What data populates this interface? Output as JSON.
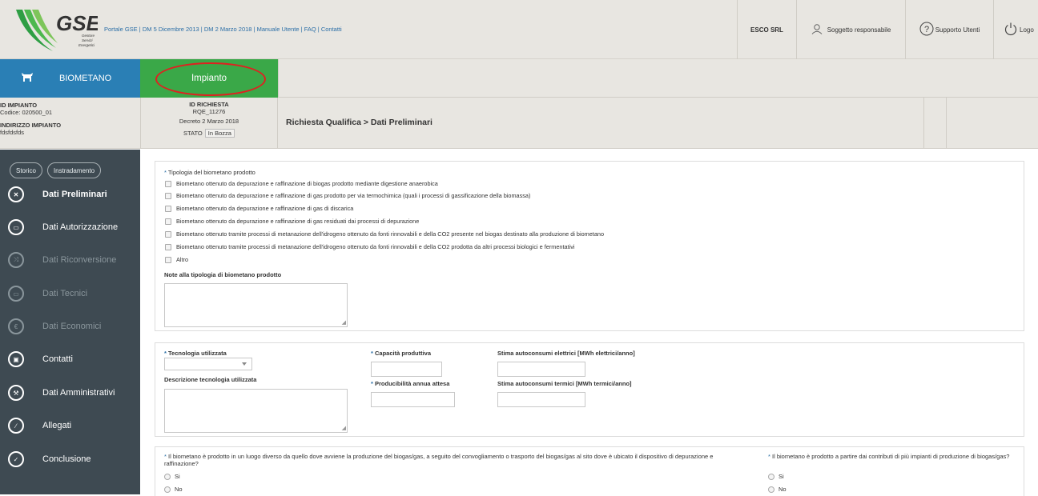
{
  "header": {
    "logo_text": "GSE",
    "logo_sub": "Gestore Servizi Energetici",
    "links": [
      "Portale GSE",
      "DM 5 Dicembre 2013",
      "DM 2 Marzo 2018",
      "Manuale Utente",
      "FAQ",
      "Contatti"
    ],
    "company": "ESCO SRL",
    "role": "Soggetto responsabile",
    "support": "Supporto Utenti",
    "logout": "Logo"
  },
  "tabs": {
    "bio": "BIOMETANO",
    "impianto": "Impianto"
  },
  "info": {
    "id_impianto_label": "ID IMPIANTO",
    "codice": "Codice: 020500_01",
    "indirizzo_label": "INDIRIZZO IMPIANTO",
    "indirizzo": "fdsfdsfds",
    "id_richiesta_label": "ID RICHIESTA",
    "id_richiesta": "RQE_11276",
    "decreto": "Decreto 2 Marzo 2018",
    "stato_label": "STATO",
    "stato": "In Bozza",
    "breadcrumb": "Richiesta Qualifica > Dati Preliminari"
  },
  "sidebar": {
    "btn_storico": "Storico",
    "btn_instradamento": "Instradamento",
    "items": [
      {
        "label": "Dati Preliminari",
        "icon": "tools-icon"
      },
      {
        "label": "Dati Autorizzazione",
        "icon": "calendar-icon"
      },
      {
        "label": "Dati Riconversione",
        "icon": "shuffle-icon"
      },
      {
        "label": "Dati Tecnici",
        "icon": "monitor-icon"
      },
      {
        "label": "Dati Economici",
        "icon": "euro-icon"
      },
      {
        "label": "Contatti",
        "icon": "contact-card-icon"
      },
      {
        "label": "Dati Amministrativi",
        "icon": "wrench-icon"
      },
      {
        "label": "Allegati",
        "icon": "paperclip-icon"
      },
      {
        "label": "Conclusione",
        "icon": "check-icon"
      }
    ]
  },
  "form": {
    "tipologia_label": "Tipologia del biometano prodotto",
    "tipologia_options": [
      "Biometano ottenuto da depurazione e raffinazione di biogas prodotto mediante digestione anaerobica",
      "Biometano ottenuto da depurazione e raffinazione di gas prodotto per via termochimica (quali i processi di gassificazione della biomassa)",
      "Biometano ottenuto da depurazione e raffinazione di gas di discarica",
      "Biometano ottenuto da depurazione e raffinazione di gas residuati dai processi di depurazione",
      "Biometano ottenuto tramite processi di metanazione dell'idrogeno ottenuto da fonti rinnovabili e della CO2 presente nel biogas destinato alla produzione di biometano",
      "Biometano ottenuto tramite processi di metanazione dell'idrogeno ottenuto da fonti rinnovabili e della CO2 prodotta da altri processi biologici e fermentativi",
      "Altro"
    ],
    "note_label": "Note alla tipologia di biometano prodotto",
    "tecnologia_label": "Tecnologia utilizzata",
    "descr_tecnologia_label": "Descrizione tecnologia utilizzata",
    "capacita_label": "Capacità produttiva",
    "producibilita_label": "Producibilità annua attesa",
    "autocons_el_label": "Stima autoconsumi elettrici [MWh elettrici/anno]",
    "autocons_term_label": "Stima autoconsumi termici [MWh termici/anno]",
    "q1_label": "Il biometano è prodotto in un luogo diverso da quello dove avviene la produzione del biogas/gas, a seguito del convogliamento o trasporto del biogas/gas al sito dove è ubicato il dispositivo di depurazione e raffinazione?",
    "q2_label": "Il biometano è prodotto a partire dai contributi di più impianti di produzione di biogas/gas?",
    "si": "Si",
    "no": "No"
  }
}
